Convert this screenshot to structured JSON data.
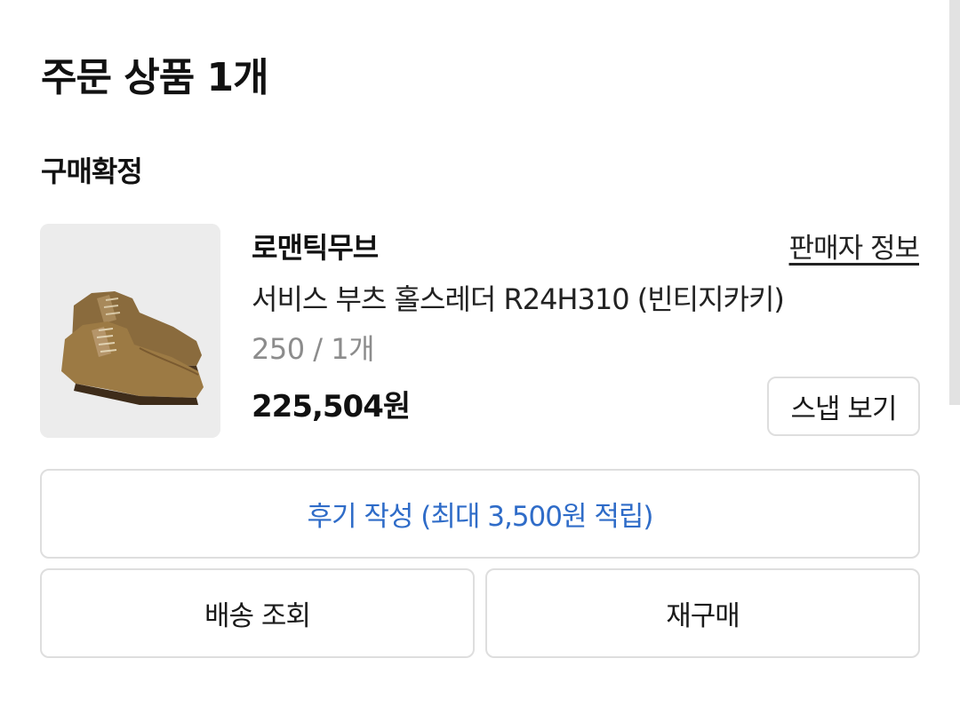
{
  "order": {
    "title": "주문 상품 1개",
    "status": "구매확정"
  },
  "item": {
    "brand": "로맨틱무브",
    "seller_link": "판매자 정보",
    "name": "서비스 부츠 홀스레더 R24H310 (빈티지카키)",
    "option": "250 / 1개",
    "price": "225,504원",
    "snap_label": "스냅 보기",
    "image_icon": "boots-product-image"
  },
  "actions": {
    "review_label": "후기 작성  (최대 3,500원 적립)",
    "shipping_label": "배송 조회",
    "rebuy_label": "재구매"
  },
  "colors": {
    "review_accent": "#2f6cc8",
    "border": "#dedede",
    "thumb_bg": "#ececec",
    "muted_text": "#8c8c8c"
  }
}
